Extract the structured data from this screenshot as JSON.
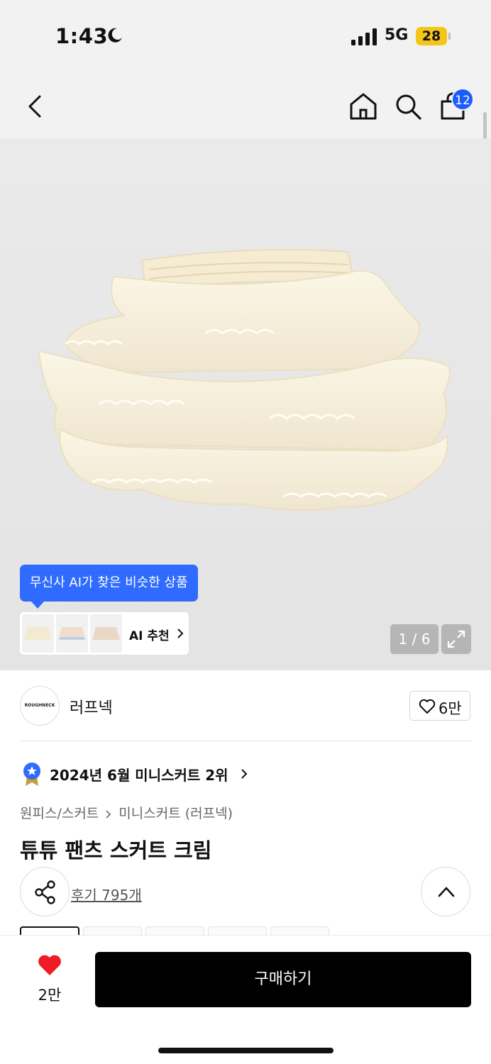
{
  "status_bar": {
    "time": "1:43",
    "network": "5G",
    "battery": "28"
  },
  "nav": {
    "cart_count": "12"
  },
  "image_gallery": {
    "ai_tooltip": "무신사 AI가 찾은 비슷한 상품",
    "ai_recommend_label": "AI 추천",
    "counter": "1 / 6"
  },
  "brand": {
    "logo_text": "ROUGHNECK",
    "name": "러프넥",
    "like_count": "6만"
  },
  "rank": {
    "text": "2024년 6월 미니스커트 2위"
  },
  "breadcrumb": {
    "category": "원피스/스커트",
    "subcategory": "미니스커트 (러프넥)"
  },
  "product": {
    "title": "튜튜 팬츠 스커트 크림",
    "reviews": "후기 795개"
  },
  "bottom_bar": {
    "like_count": "2만",
    "buy_label": "구매하기"
  },
  "colors": {
    "accent": "#2f6bff",
    "badge": "#1a5cff",
    "like_red": "#ee1c25",
    "buy_bg": "#000000",
    "battery": "#f5c518"
  }
}
